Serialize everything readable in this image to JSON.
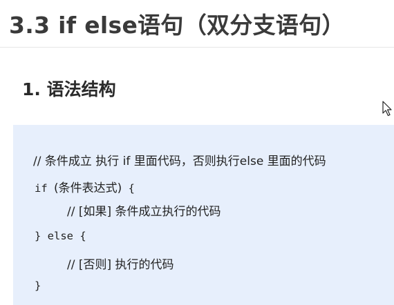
{
  "title": "3.3 if else语句（双分支语句）",
  "section": {
    "heading": "1. 语法结构"
  },
  "code": {
    "line1": "// 条件成立  执行 if 里面代码，否则执行else 里面的代码",
    "line2_keyword": "if ",
    "line2_cond": "(条件表达式)",
    "line2_brace": " {",
    "line3": "// [如果] 条件成立执行的代码",
    "line4": "} else {",
    "line5": "// [否则] 执行的代码",
    "line6": "}"
  },
  "colors": {
    "code_background": "#e7effc",
    "title_text": "#3a3a3a"
  },
  "icons": [
    "mouse-cursor-icon"
  ]
}
